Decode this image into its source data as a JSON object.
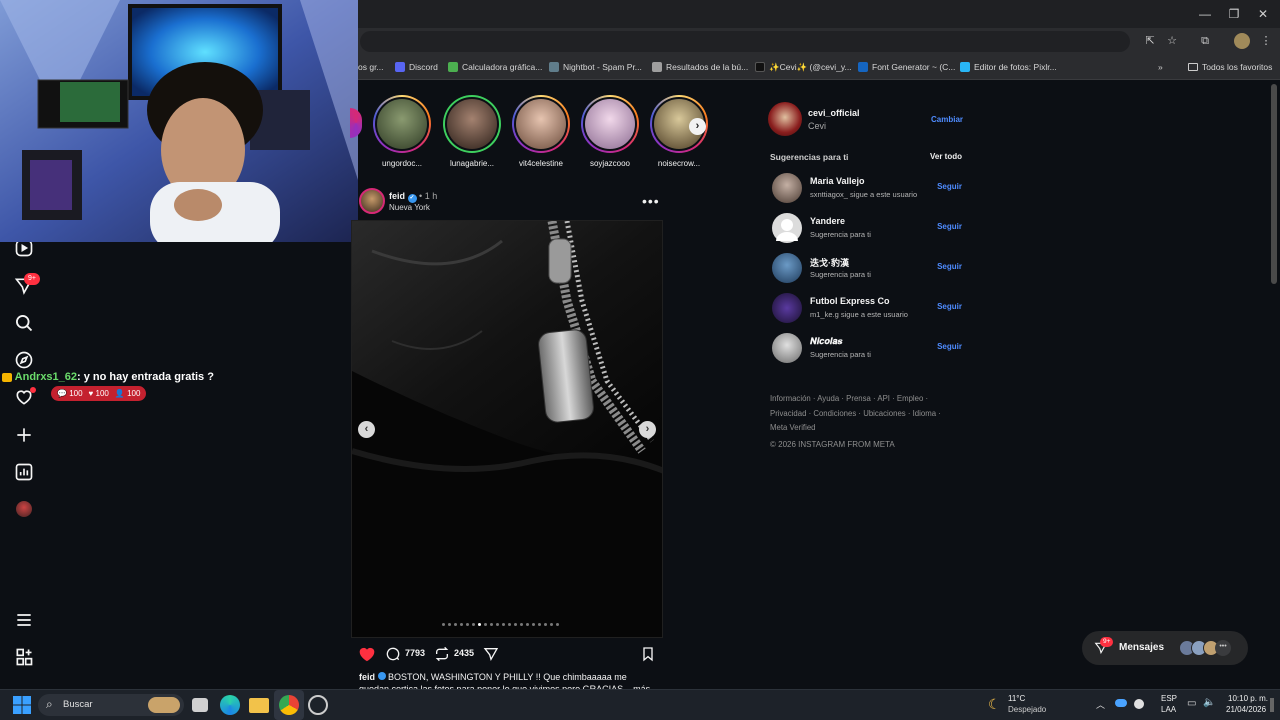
{
  "bookmarks": [
    {
      "label": "os gr...",
      "color": "#888888"
    },
    {
      "label": "Discord",
      "color": "#5865f2"
    },
    {
      "label": "Calculadora gráfica...",
      "color": "#4caf50"
    },
    {
      "label": "Nightbot - Spam Pr...",
      "color": "#607d8b"
    },
    {
      "label": "Resultados de la bú...",
      "color": "#9e9e9e"
    },
    {
      "label": "✨Cevi✨ (@cevi_y...",
      "color": "#111111"
    },
    {
      "label": "Font Generator ~ (C...",
      "color": "#1565c0"
    },
    {
      "label": "Editor de fotos: Pixlr...",
      "color": "#29b6f6"
    }
  ],
  "bookmarks_all": "Todos los favoritos",
  "chat": {
    "user": "Andrxs1_62",
    "message": ": y no hay entrada gratis ?",
    "stats": [
      "100",
      "100",
      "100"
    ]
  },
  "nav": {
    "notification_badge": "9+"
  },
  "stories": [
    {
      "name": "ungordoc...",
      "ring": "grad",
      "color": "#6b7a55"
    },
    {
      "name": "lunagabrie...",
      "ring": "green",
      "color": "#5a4438"
    },
    {
      "name": "vit4celestine",
      "ring": "grad",
      "color": "#c9a38e"
    },
    {
      "name": "soyjazcooo",
      "ring": "grad",
      "color": "#d9b6cf"
    },
    {
      "name": "noisecrow...",
      "ring": "grad",
      "color": "#b09a6a"
    }
  ],
  "post": {
    "user": "feid",
    "time": "• 1 h",
    "location": "Nueva York",
    "likes_icon": "heart-icon",
    "comments": "7793",
    "reposts": "2435",
    "caption_user": "feid",
    "caption": "BOSTON, WASHINGTON Y PHILLY !! Que chimbaaaaa me quedan cortica las fotos para poner lo que vivimos pero GRACIAS... más"
  },
  "profile": {
    "username": "cevi_official",
    "name": "Cevi",
    "switch": "Cambiar"
  },
  "suggestions": {
    "title": "Sugerencias para ti",
    "see_all": "Ver todo",
    "follow": "Seguir",
    "items": [
      {
        "user": "Maria Vallejo",
        "sub": "sxnttiagox_ sigue a este usuario",
        "color": "#8a7a70"
      },
      {
        "user": "Yandere",
        "sub": "Sugerencia para ti",
        "color": "#d9d9d9"
      },
      {
        "user": "迭戈·豹漢",
        "sub": "Sugerencia para ti",
        "color": "#3d6a96"
      },
      {
        "user": "Futbol Express Co",
        "sub": "m1_ke.g sigue a este usuario",
        "color": "#3a2a6a"
      },
      {
        "user": "𝑵𝒊𝒄𝒐𝒍𝒂𝒔",
        "sub": "Sugerencia para ti",
        "color": "#bdbdbd"
      }
    ]
  },
  "footer_links_1": [
    "Información",
    "Ayuda",
    "Prensa",
    "API",
    "Empleo"
  ],
  "footer_links_2": [
    "Privacidad",
    "Condiciones",
    "Ubicaciones",
    "Idioma"
  ],
  "footer_links_3": [
    "Meta Verified"
  ],
  "copyright": "© 2026 INSTAGRAM FROM META",
  "messages": {
    "label": "Mensajes",
    "badge": "9+"
  },
  "taskbar": {
    "search": "Buscar",
    "temp": "11°C",
    "weather": "Despejado",
    "lang1": "ESP",
    "lang2": "LAA",
    "time": "10:10 p. m.",
    "date": "21/04/2026"
  }
}
